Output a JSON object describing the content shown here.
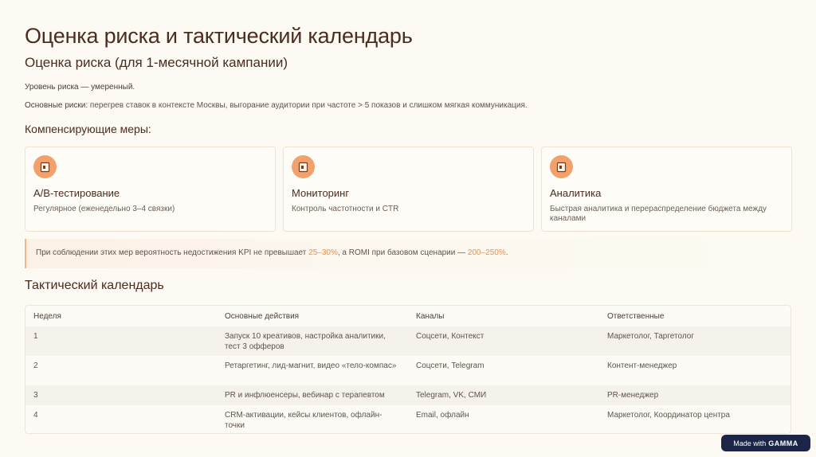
{
  "title": "Оценка риска и тактический календарь",
  "subtitle": "Оценка риска (для 1-месячной кампании)",
  "risk_level": "Уровень риска — умеренный.",
  "main_risks_label": "Основные риски:",
  "main_risks_text": " перегрев ставок в контексте Москвы, выгорание аудитории при частоте > 5 показов и слишком мягкая коммуникация.",
  "measures_heading": "Компенсирующие меры:",
  "cards": [
    {
      "icon": "document-icon",
      "title": "A/B-тестирование",
      "desc": "Регулярное (еженедельно 3–4 связки)"
    },
    {
      "icon": "document-icon",
      "title": "Мониторинг",
      "desc": "Контроль частотности и CTR"
    },
    {
      "icon": "document-icon",
      "title": "Аналитика",
      "desc": "Быстрая аналитика и перераспределение бюджета между каналами"
    }
  ],
  "callout": {
    "part1": "При соблюдении этих мер вероятность недостижения KPI не превышает ",
    "hl1": "25–30%",
    "part2": ", а ROMI при базовом сценарии — ",
    "hl2": "200–250%",
    "part3": "."
  },
  "calendar_heading": "Тактический календарь",
  "table": {
    "headers": [
      "Неделя",
      "Основные действия",
      "Каналы",
      "Ответственные"
    ],
    "rows": [
      [
        "1",
        "Запуск 10 креативов, настройка аналитики, тест 3 офферов",
        "Соцсети, Контекст",
        "Маркетолог, Таргетолог"
      ],
      [
        "2",
        "Ретаргетинг, лид-магнит, видео «тело-компас»",
        "Соцсети, Telegram",
        "Контент-менеджер"
      ],
      [
        "3",
        "PR и инфлюенсеры, вебинар с терапевтом",
        "Telegram, VK, СМИ",
        "PR-менеджер"
      ],
      [
        "4",
        "CRM-активации, кейсы клиентов, офлайн-точки",
        "Email, офлайн",
        "Маркетолог, Координатор центра"
      ]
    ]
  },
  "badge": {
    "prefix": "Made with",
    "brand": "GAMMA"
  },
  "colors": {
    "accent": "#f2a16c",
    "highlight": "#ef8f45",
    "background": "#fcfaf2",
    "badge_bg": "#1b2548"
  }
}
